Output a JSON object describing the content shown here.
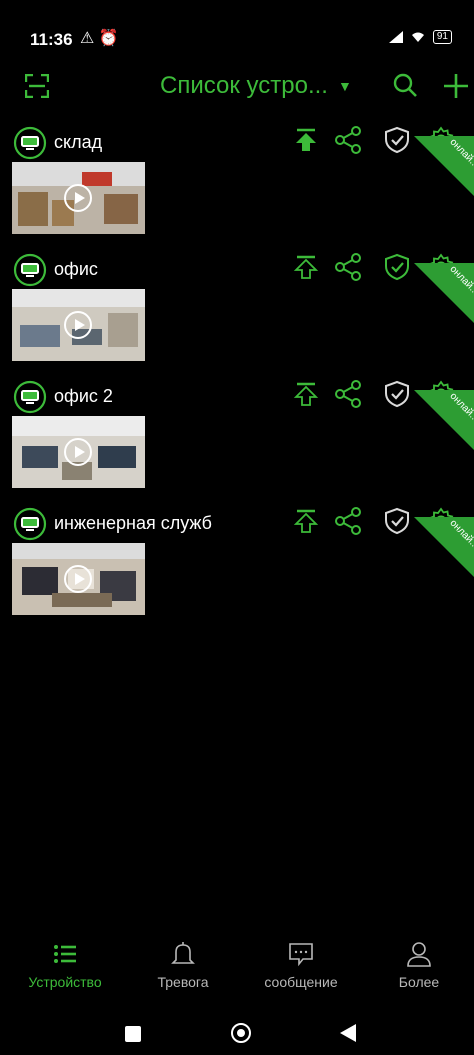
{
  "status_bar": {
    "time": "11:36",
    "left_icons": "⚠ ⏰",
    "battery": "91"
  },
  "header": {
    "title": "Список устро...",
    "scan_icon": "scan-icon",
    "search_icon": "search-icon",
    "add_icon": "plus-icon"
  },
  "devices": [
    {
      "name": "склад",
      "status": "онлай..."
    },
    {
      "name": "офис",
      "status": "онлай..."
    },
    {
      "name": "офис 2",
      "status": "онлай..."
    },
    {
      "name": "инженерная служб",
      "status": "онлай..."
    }
  ],
  "tabs": [
    {
      "label": "Устройство",
      "icon": "list-icon",
      "active": true
    },
    {
      "label": "Тревога",
      "icon": "bell-icon",
      "active": false
    },
    {
      "label": "сообщение",
      "icon": "message-icon",
      "active": false
    },
    {
      "label": "Более",
      "icon": "person-icon",
      "active": false
    }
  ],
  "colors": {
    "accent": "#3dbb3a",
    "background": "#000000",
    "ribbon": "#2d9d33"
  }
}
